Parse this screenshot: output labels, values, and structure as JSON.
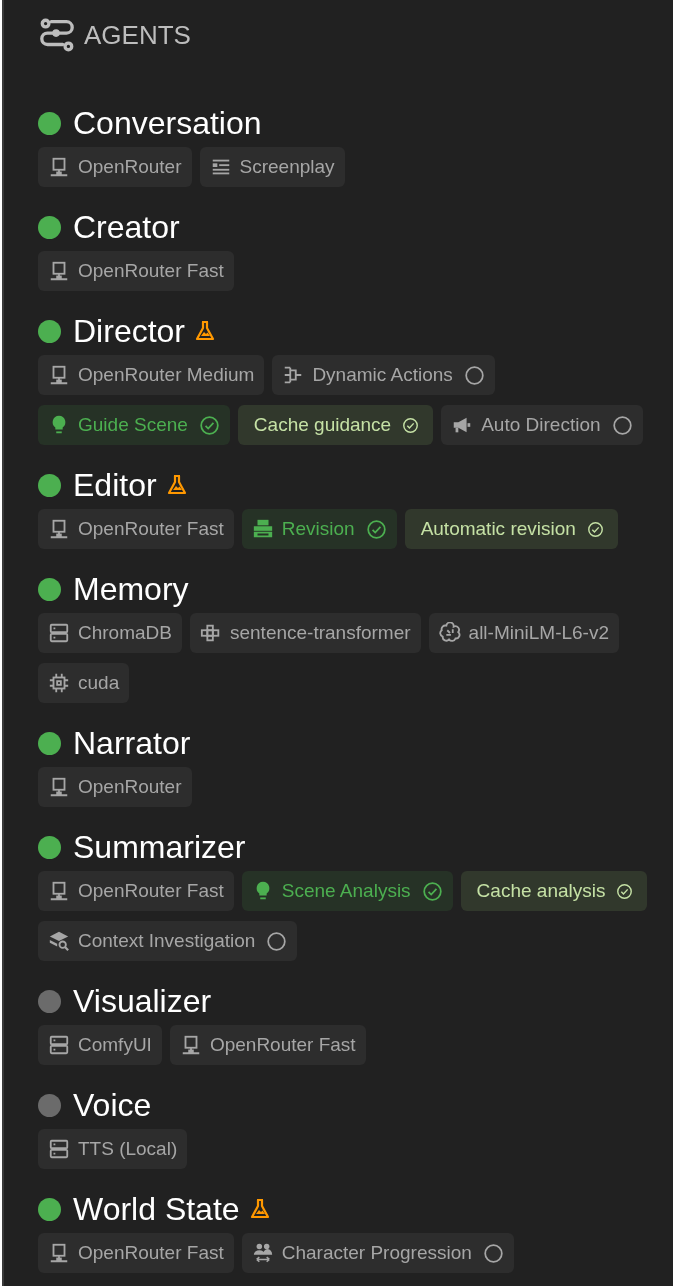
{
  "header": {
    "title": "AGENTS"
  },
  "agents": [
    {
      "name": "Conversation",
      "active": true,
      "experimental": false,
      "chips": [
        {
          "kind": "client",
          "label": "OpenRouter"
        },
        {
          "kind": "screenplay",
          "label": "Screenplay"
        }
      ]
    },
    {
      "name": "Creator",
      "active": true,
      "experimental": false,
      "chips": [
        {
          "kind": "client",
          "label": "OpenRouter Fast"
        }
      ]
    },
    {
      "name": "Director",
      "active": true,
      "experimental": true,
      "chips": [
        {
          "kind": "client",
          "label": "OpenRouter Medium"
        },
        {
          "kind": "actions",
          "label": "Dynamic Actions",
          "enabled": false
        },
        {
          "kind": "guide",
          "label": "Guide Scene",
          "enabled": true
        },
        {
          "kind": "cache",
          "label": "Cache guidance",
          "enabled": true
        },
        {
          "kind": "direction",
          "label": "Auto Direction",
          "enabled": false
        }
      ]
    },
    {
      "name": "Editor",
      "active": true,
      "experimental": true,
      "chips": [
        {
          "kind": "client",
          "label": "OpenRouter Fast"
        },
        {
          "kind": "revision",
          "label": "Revision",
          "enabled": true
        },
        {
          "kind": "cache",
          "label": "Automatic revision",
          "enabled": true
        }
      ]
    },
    {
      "name": "Memory",
      "active": true,
      "experimental": false,
      "chips": [
        {
          "kind": "database",
          "label": "ChromaDB"
        },
        {
          "kind": "embeddings",
          "label": "sentence-transformer"
        },
        {
          "kind": "model",
          "label": "all-MiniLM-L6-v2"
        },
        {
          "kind": "device",
          "label": "cuda"
        }
      ]
    },
    {
      "name": "Narrator",
      "active": true,
      "experimental": false,
      "chips": [
        {
          "kind": "client",
          "label": "OpenRouter"
        }
      ]
    },
    {
      "name": "Summarizer",
      "active": true,
      "experimental": false,
      "chips": [
        {
          "kind": "client",
          "label": "OpenRouter Fast"
        },
        {
          "kind": "guide",
          "label": "Scene Analysis",
          "enabled": true
        },
        {
          "kind": "cache",
          "label": "Cache analysis",
          "enabled": true
        },
        {
          "kind": "investigation",
          "label": "Context Investigation",
          "enabled": false
        }
      ]
    },
    {
      "name": "Visualizer",
      "active": false,
      "experimental": false,
      "chips": [
        {
          "kind": "database",
          "label": "ComfyUI"
        },
        {
          "kind": "client",
          "label": "OpenRouter Fast"
        }
      ]
    },
    {
      "name": "Voice",
      "active": false,
      "experimental": false,
      "chips": [
        {
          "kind": "database",
          "label": "TTS (Local)"
        }
      ]
    },
    {
      "name": "World State",
      "active": true,
      "experimental": true,
      "chips": [
        {
          "kind": "client",
          "label": "OpenRouter Fast"
        },
        {
          "kind": "progression",
          "label": "Character Progression",
          "enabled": false
        }
      ]
    }
  ]
}
